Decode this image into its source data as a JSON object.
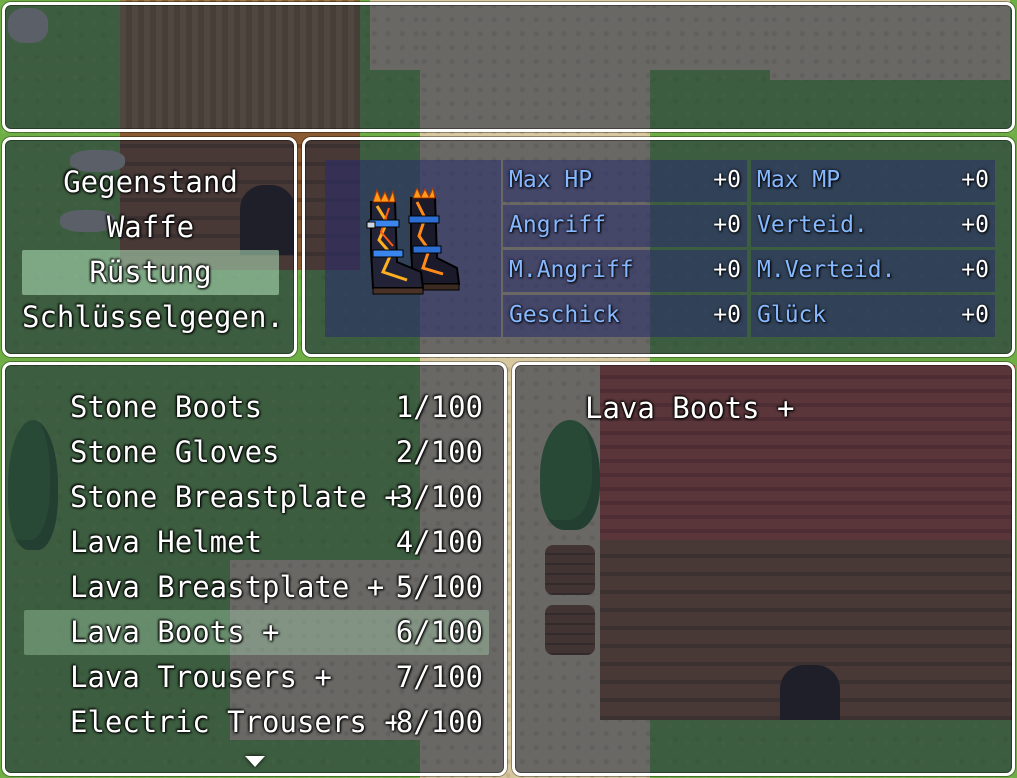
{
  "categories": {
    "items": [
      {
        "label": "Gegenstand",
        "selected": false
      },
      {
        "label": "Waffe",
        "selected": false
      },
      {
        "label": "Rüstung",
        "selected": true
      },
      {
        "label": "Schlüsselgegen.",
        "selected": false
      }
    ]
  },
  "status": {
    "item_icon": "lava-boots-icon",
    "stats": [
      {
        "label": "Max HP",
        "value": "+0"
      },
      {
        "label": "Max MP",
        "value": "+0"
      },
      {
        "label": "Angriff",
        "value": "+0"
      },
      {
        "label": "Verteid.",
        "value": "+0"
      },
      {
        "label": "M.Angriff",
        "value": "+0"
      },
      {
        "label": "M.Verteid.",
        "value": "+0"
      },
      {
        "label": "Geschick",
        "value": "+0"
      },
      {
        "label": "Glück",
        "value": "+0"
      }
    ]
  },
  "item_list": {
    "items": [
      {
        "name": "Stone Boots",
        "count": "1/100",
        "selected": false
      },
      {
        "name": "Stone Gloves",
        "count": "2/100",
        "selected": false
      },
      {
        "name": "Stone Breastplate +",
        "count": "3/100",
        "selected": false
      },
      {
        "name": "Lava Helmet",
        "count": "4/100",
        "selected": false
      },
      {
        "name": "Lava Breastplate +",
        "count": "5/100",
        "selected": false
      },
      {
        "name": "Lava Boots +",
        "count": "6/100",
        "selected": true
      },
      {
        "name": "Lava Trousers +",
        "count": "7/100",
        "selected": false
      },
      {
        "name": "Electric Trousers +",
        "count": "8/100",
        "selected": false
      }
    ],
    "scroll_indicator": "down-arrow-icon"
  },
  "detail": {
    "item_name": "Lava Boots +"
  },
  "colors": {
    "window_border": "#ffffff",
    "stat_label": "#86b8ff",
    "highlight": "#b4e6be"
  }
}
